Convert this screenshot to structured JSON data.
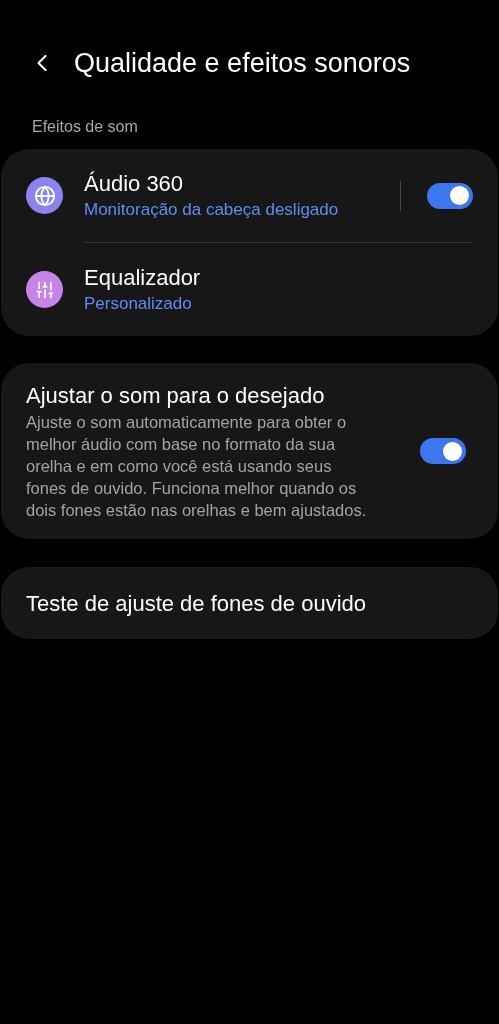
{
  "header": {
    "title": "Qualidade e efeitos sonoros"
  },
  "section_label": "Efeitos de som",
  "effects": [
    {
      "kind": "toggle",
      "color": "#8c83ee",
      "title": "Áudio 360",
      "subtitle": "Monitoração da cabeça desligado",
      "on": true
    },
    {
      "kind": "link",
      "color": "#c783e6",
      "title": "Equalizador",
      "subtitle": "Personalizado"
    }
  ],
  "adapt": {
    "title": "Ajustar o som para o desejado",
    "description": "Ajuste o som automaticamente para obter o melhor áudio com base no formato da sua orelha e em como você está usando seus fones de ouvido. Funciona melhor quando os dois fones estão nas orelhas e bem ajustados.",
    "on": true
  },
  "fit_test": {
    "title": "Teste de ajuste de fones de ouvido"
  }
}
